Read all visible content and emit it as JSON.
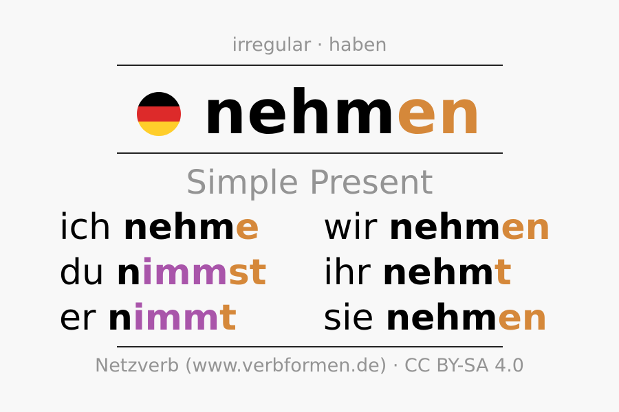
{
  "header": {
    "meta": "irregular · haben"
  },
  "title": {
    "stem": "nehm",
    "ending": "en"
  },
  "flag": {
    "colors": [
      "#000000",
      "#dd2a2a",
      "#ffce2b"
    ]
  },
  "tense": "Simple Present",
  "colors": {
    "ending": "#d5883a",
    "stem_change": "#a955aa",
    "regular": "#000000"
  },
  "conjugation": [
    {
      "pronoun": "ich",
      "parts": [
        {
          "text": "nehm",
          "type": "regular"
        },
        {
          "text": "e",
          "type": "ending"
        }
      ]
    },
    {
      "pronoun": "wir",
      "parts": [
        {
          "text": "nehm",
          "type": "regular"
        },
        {
          "text": "en",
          "type": "ending"
        }
      ]
    },
    {
      "pronoun": "du",
      "parts": [
        {
          "text": "n",
          "type": "regular"
        },
        {
          "text": "imm",
          "type": "stem_change"
        },
        {
          "text": "st",
          "type": "ending"
        }
      ]
    },
    {
      "pronoun": "ihr",
      "parts": [
        {
          "text": "nehm",
          "type": "regular"
        },
        {
          "text": "t",
          "type": "ending"
        }
      ]
    },
    {
      "pronoun": "er",
      "parts": [
        {
          "text": "n",
          "type": "regular"
        },
        {
          "text": "imm",
          "type": "stem_change"
        },
        {
          "text": "t",
          "type": "ending"
        }
      ]
    },
    {
      "pronoun": "sie",
      "parts": [
        {
          "text": "nehm",
          "type": "regular"
        },
        {
          "text": "en",
          "type": "ending"
        }
      ]
    }
  ],
  "footer": "Netzverb (www.verbformen.de) · CC BY-SA 4.0"
}
